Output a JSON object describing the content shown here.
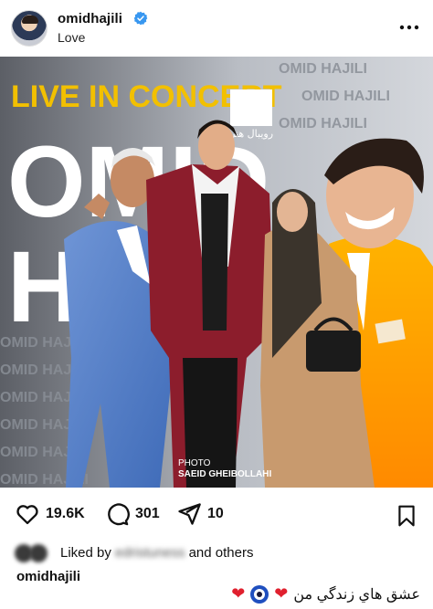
{
  "post": {
    "username": "omidhajili",
    "subtitle": "Love",
    "verified": true,
    "icons": {
      "more": "more-dots-icon",
      "verified": "verified-badge-icon"
    }
  },
  "photo": {
    "backdrop_headline": "LIVE IN CONCERT",
    "backdrop_name_1": "OMID",
    "backdrop_name_2": "HA",
    "backdrop_repeat": "OMID HAJILI",
    "backdrop_logo_text": "رویبال هنر",
    "photo_credit_label": "PHOTO",
    "photo_credit_name": "SAEID GHEIBOLLAHI"
  },
  "actions": {
    "like_count": "19.6K",
    "comment_count": "301",
    "share_count": "10",
    "icons": {
      "like": "heart-icon",
      "comment": "comment-bubble-icon",
      "share": "send-icon",
      "save": "bookmark-icon"
    }
  },
  "likes": {
    "prefix": "Liked by",
    "blurred_user": "edristuness",
    "suffix": "and others"
  },
  "caption": {
    "username": "omidhajili",
    "text": "عشق هاي زندگي من",
    "emoji_heart": "❤",
    "emoji_eye": "nazar-amulet-icon"
  },
  "colors": {
    "verified": "#3897f0",
    "heart": "#e0202e",
    "headline": "#f2c000"
  }
}
